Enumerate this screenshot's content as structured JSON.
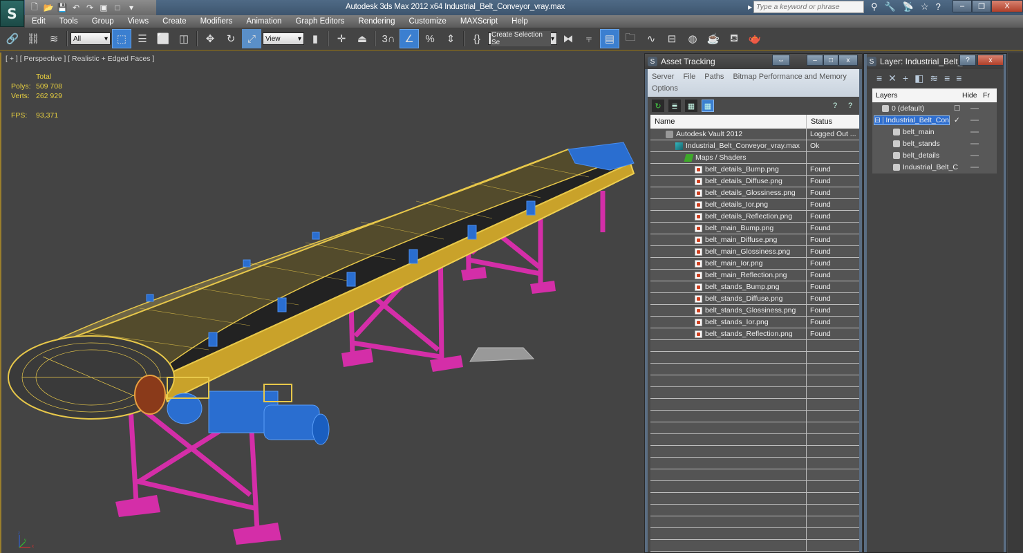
{
  "app": {
    "logo": "S",
    "title": "Autodesk 3ds Max  2012 x64     Industrial_Belt_Conveyor_vray.max",
    "quick_access": [
      "new-icon",
      "open-icon",
      "save-icon",
      "undo-icon",
      "redo-icon",
      "project-icon",
      "window-icon",
      "more-icon"
    ],
    "search_placeholder": "Type a keyword or phrase",
    "search_icons": [
      "binoculars-icon",
      "key-icon",
      "satellite-icon",
      "star-icon",
      "help-icon"
    ],
    "window_controls": {
      "minimize": "–",
      "restore": "❐",
      "close": "X"
    }
  },
  "menu": [
    "Edit",
    "Tools",
    "Group",
    "Views",
    "Create",
    "Modifiers",
    "Animation",
    "Graph Editors",
    "Rendering",
    "Customize",
    "MAXScript",
    "Help"
  ],
  "toolbar": {
    "filter_select": "All",
    "coord_select": "View",
    "selection_set": "Create Selection Se"
  },
  "viewport": {
    "label": "[ + ] [ Perspective ] [ Realistic + Edged Faces ]",
    "stats": {
      "header": "Total",
      "polys_label": "Polys:",
      "polys_value": "509 708",
      "verts_label": "Verts:",
      "verts_value": "262 929",
      "fps_label": "FPS:",
      "fps_value": "93,371"
    },
    "colors": {
      "belt": "#e8c84a",
      "rollers": "#2a6ed0",
      "stands": "#d42ea8",
      "background": "#444444"
    },
    "axis": {
      "x": "x",
      "y": "y",
      "z": "z"
    }
  },
  "asset_tracking": {
    "title": "Asset Tracking",
    "menu": [
      "Server",
      "File",
      "Paths",
      "Bitmap Performance and Memory",
      "Options"
    ],
    "columns": [
      "Name",
      "Status"
    ],
    "rows": [
      {
        "name": "Autodesk Vault 2012",
        "status": "Logged Out ...",
        "icon": "vault",
        "level": 1
      },
      {
        "name": "Industrial_Belt_Conveyor_vray.max",
        "status": "Ok",
        "icon": "max",
        "level": 2
      },
      {
        "name": "Maps / Shaders",
        "status": "",
        "icon": "maps",
        "level": 3
      },
      {
        "name": "belt_details_Bump.png",
        "status": "Found",
        "icon": "png",
        "level": 4
      },
      {
        "name": "belt_details_Diffuse.png",
        "status": "Found",
        "icon": "png",
        "level": 4
      },
      {
        "name": "belt_details_Glossiness.png",
        "status": "Found",
        "icon": "png",
        "level": 4
      },
      {
        "name": "belt_details_Ior.png",
        "status": "Found",
        "icon": "png",
        "level": 4
      },
      {
        "name": "belt_details_Reflection.png",
        "status": "Found",
        "icon": "png",
        "level": 4
      },
      {
        "name": "belt_main_Bump.png",
        "status": "Found",
        "icon": "png",
        "level": 4
      },
      {
        "name": "belt_main_Diffuse.png",
        "status": "Found",
        "icon": "png",
        "level": 4
      },
      {
        "name": "belt_main_Glossiness.png",
        "status": "Found",
        "icon": "png",
        "level": 4
      },
      {
        "name": "belt_main_Ior.png",
        "status": "Found",
        "icon": "png",
        "level": 4
      },
      {
        "name": "belt_main_Reflection.png",
        "status": "Found",
        "icon": "png",
        "level": 4
      },
      {
        "name": "belt_stands_Bump.png",
        "status": "Found",
        "icon": "png",
        "level": 4
      },
      {
        "name": "belt_stands_Diffuse.png",
        "status": "Found",
        "icon": "png",
        "level": 4
      },
      {
        "name": "belt_stands_Glossiness.png",
        "status": "Found",
        "icon": "png",
        "level": 4
      },
      {
        "name": "belt_stands_Ior.png",
        "status": "Found",
        "icon": "png",
        "level": 4
      },
      {
        "name": "belt_stands_Reflection.png",
        "status": "Found",
        "icon": "png",
        "level": 4
      }
    ]
  },
  "layer_manager": {
    "title": "Layer: Industrial_Belt_...",
    "columns": [
      "Layers",
      "Hide",
      "Fr"
    ],
    "rows": [
      {
        "name": "0 (default)",
        "type": "layer",
        "selected": false,
        "current": false
      },
      {
        "name": "Industrial_Belt_Con",
        "type": "layer",
        "selected": true,
        "current": true
      },
      {
        "name": "belt_main",
        "type": "object",
        "selected": false
      },
      {
        "name": "belt_stands",
        "type": "object",
        "selected": false
      },
      {
        "name": "belt_details",
        "type": "object",
        "selected": false
      },
      {
        "name": "Industrial_Belt_C",
        "type": "object",
        "selected": false
      }
    ]
  }
}
